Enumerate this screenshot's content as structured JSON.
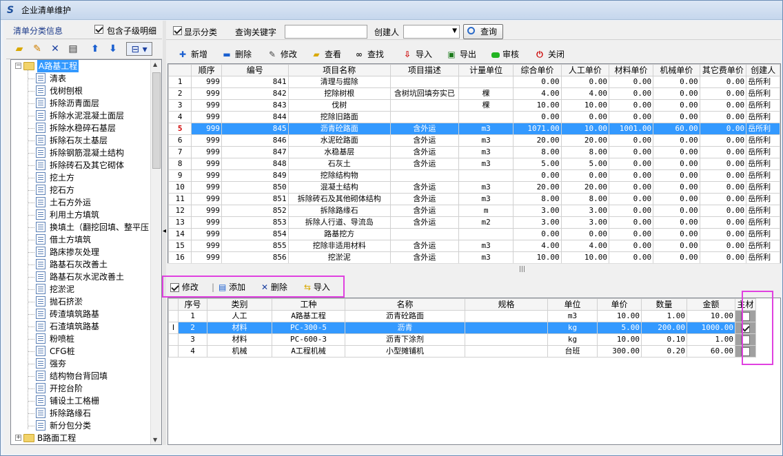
{
  "window": {
    "title": "企业清单维护"
  },
  "left": {
    "title": "清单分类信息",
    "include_children_label": "包含子级明细",
    "include_children_checked": true,
    "tree": [
      {
        "label": "A路基工程",
        "level": 0,
        "expanded": true,
        "selected": true
      },
      {
        "label": "清表",
        "level": 1
      },
      {
        "label": "伐树刨根",
        "level": 1
      },
      {
        "label": "拆除沥青面层",
        "level": 1
      },
      {
        "label": "拆除水泥混凝土面层",
        "level": 1
      },
      {
        "label": "拆除水稳碎石基层",
        "level": 1
      },
      {
        "label": "拆除石灰土基层",
        "level": 1
      },
      {
        "label": "拆除钢筋混凝土结构",
        "level": 1
      },
      {
        "label": "拆除砖石及其它砌体",
        "level": 1
      },
      {
        "label": "挖土方",
        "level": 1
      },
      {
        "label": "挖石方",
        "level": 1
      },
      {
        "label": "土石方外运",
        "level": 1
      },
      {
        "label": "利用土方填筑",
        "level": 1
      },
      {
        "label": "换填土（翻挖回填、整平压",
        "level": 1
      },
      {
        "label": "借土方填筑",
        "level": 1
      },
      {
        "label": "路床掺灰处理",
        "level": 1
      },
      {
        "label": "路基石灰改善土",
        "level": 1
      },
      {
        "label": "路基石灰水泥改善土",
        "level": 1
      },
      {
        "label": "挖淤泥",
        "level": 1
      },
      {
        "label": "抛石挤淤",
        "level": 1
      },
      {
        "label": "砖渣填筑路基",
        "level": 1
      },
      {
        "label": "石渣填筑路基",
        "level": 1
      },
      {
        "label": "粉喷桩",
        "level": 1
      },
      {
        "label": "CFG桩",
        "level": 1
      },
      {
        "label": "强夯",
        "level": 1
      },
      {
        "label": "结构物台背回填",
        "level": 1
      },
      {
        "label": "开挖台阶",
        "level": 1
      },
      {
        "label": "铺设土工格栅",
        "level": 1
      },
      {
        "label": "拆除路缘石",
        "level": 1
      },
      {
        "label": "新分包分类",
        "level": 1
      },
      {
        "label": "B路面工程",
        "level": 0,
        "expanded": false
      }
    ]
  },
  "query": {
    "show_category_label": "显示分类",
    "show_category_checked": true,
    "keyword_label": "查询关键字",
    "keyword_value": "",
    "creator_label": "创建人",
    "creator_value": "",
    "query_button": "查询"
  },
  "toolbar": {
    "add": "新增",
    "delete": "删除",
    "edit": "修改",
    "view": "查看",
    "find": "查找",
    "import": "导入",
    "export": "导出",
    "audit": "审核",
    "close": "关闭"
  },
  "main_table": {
    "columns": [
      "",
      "顺序",
      "编号",
      "项目名称",
      "项目描述",
      "计量单位",
      "综合单价",
      "人工单价",
      "材料单价",
      "机械单价",
      "其它费单价",
      "创建人"
    ],
    "rows": [
      [
        "1",
        "999",
        "841",
        "清理与掘除",
        "",
        "",
        "0.00",
        "0.00",
        "0.00",
        "0.00",
        "0.00",
        "岳所利"
      ],
      [
        "2",
        "999",
        "842",
        "挖除树根",
        "含树坑回填夯实已",
        "棵",
        "4.00",
        "4.00",
        "0.00",
        "0.00",
        "0.00",
        "岳所利"
      ],
      [
        "3",
        "999",
        "843",
        "伐树",
        "",
        "棵",
        "10.00",
        "10.00",
        "0.00",
        "0.00",
        "0.00",
        "岳所利"
      ],
      [
        "4",
        "999",
        "844",
        "挖除旧路面",
        "",
        "",
        "0.00",
        "0.00",
        "0.00",
        "0.00",
        "0.00",
        "岳所利"
      ],
      [
        "5",
        "999",
        "845",
        "沥青砼路面",
        "含外运",
        "m3",
        "1071.00",
        "10.00",
        "1001.00",
        "60.00",
        "0.00",
        "岳所利"
      ],
      [
        "6",
        "999",
        "846",
        "水泥砼路面",
        "含外运",
        "m3",
        "20.00",
        "20.00",
        "0.00",
        "0.00",
        "0.00",
        "岳所利"
      ],
      [
        "7",
        "999",
        "847",
        "水稳基层",
        "含外运",
        "m3",
        "8.00",
        "8.00",
        "0.00",
        "0.00",
        "0.00",
        "岳所利"
      ],
      [
        "8",
        "999",
        "848",
        "石灰土",
        "含外运",
        "m3",
        "5.00",
        "5.00",
        "0.00",
        "0.00",
        "0.00",
        "岳所利"
      ],
      [
        "9",
        "999",
        "849",
        "挖除结构物",
        "",
        "",
        "0.00",
        "0.00",
        "0.00",
        "0.00",
        "0.00",
        "岳所利"
      ],
      [
        "10",
        "999",
        "850",
        "混凝土结构",
        "含外运",
        "m3",
        "20.00",
        "20.00",
        "0.00",
        "0.00",
        "0.00",
        "岳所利"
      ],
      [
        "11",
        "999",
        "851",
        "拆除砖石及其他砌体结构",
        "含外运",
        "m3",
        "8.00",
        "8.00",
        "0.00",
        "0.00",
        "0.00",
        "岳所利"
      ],
      [
        "12",
        "999",
        "852",
        "拆除路缘石",
        "含外运",
        "m",
        "3.00",
        "3.00",
        "0.00",
        "0.00",
        "0.00",
        "岳所利"
      ],
      [
        "13",
        "999",
        "853",
        "拆除人行道、导流岛",
        "含外运",
        "m2",
        "3.00",
        "3.00",
        "0.00",
        "0.00",
        "0.00",
        "岳所利"
      ],
      [
        "14",
        "999",
        "854",
        "路基挖方",
        "",
        "",
        "0.00",
        "0.00",
        "0.00",
        "0.00",
        "0.00",
        "岳所利"
      ],
      [
        "15",
        "999",
        "855",
        "挖除非适用材料",
        "含外运",
        "m3",
        "4.00",
        "4.00",
        "0.00",
        "0.00",
        "0.00",
        "岳所利"
      ],
      [
        "16",
        "999",
        "856",
        "挖淤泥",
        "含外运",
        "m3",
        "10.00",
        "10.00",
        "0.00",
        "0.00",
        "0.00",
        "岳所利"
      ]
    ],
    "selected_row": 5
  },
  "sub_toolbar": {
    "edit_label": "修改",
    "edit_checked": true,
    "add": "添加",
    "delete": "删除",
    "import": "导入"
  },
  "sub_table": {
    "columns": [
      "",
      "序号",
      "类别",
      "工种",
      "名称",
      "规格",
      "单位",
      "单价",
      "数量",
      "金额",
      "主材"
    ],
    "rows": [
      {
        "cells": [
          "",
          "1",
          "人工",
          "A路基工程",
          "沥青砼路面",
          "",
          "m3",
          "10.00",
          "1.00",
          "10.00"
        ],
        "main": false
      },
      {
        "cells": [
          "I",
          "2",
          "材料",
          "PC-300-5",
          "沥青",
          "",
          "kg",
          "5.00",
          "200.00",
          "1000.00"
        ],
        "main": true
      },
      {
        "cells": [
          "",
          "3",
          "材料",
          "PC-600-3",
          "沥青下涂剂",
          "",
          "kg",
          "10.00",
          "0.10",
          "1.00"
        ],
        "main": false
      },
      {
        "cells": [
          "",
          "4",
          "机械",
          "A工程机械",
          "小型摊铺机",
          "",
          "台班",
          "300.00",
          "0.20",
          "60.00"
        ],
        "main": false
      }
    ],
    "selected_row": 2
  },
  "colors": {
    "selection": "#3399ff",
    "highlight_box": "#e040e0",
    "selected_row_number": "#d00000"
  }
}
